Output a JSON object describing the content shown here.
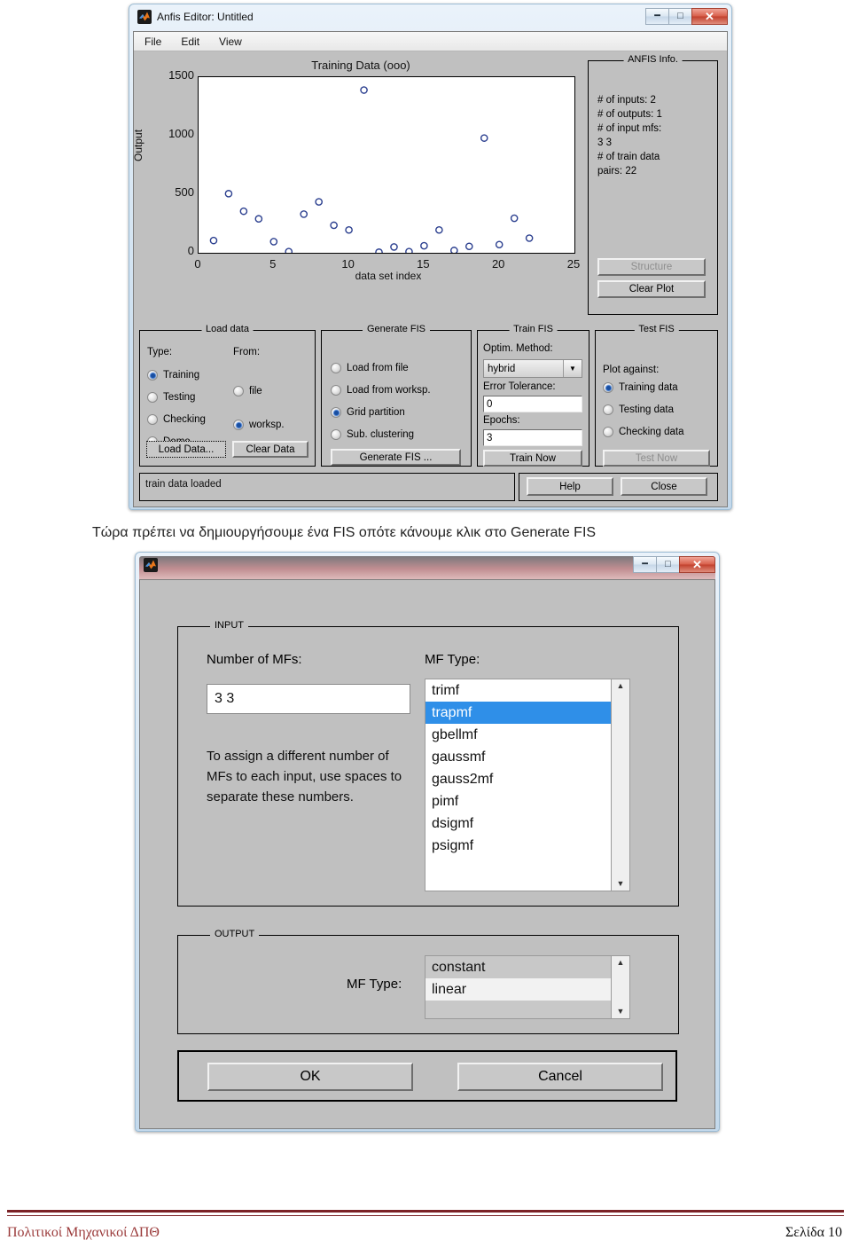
{
  "anfis_window": {
    "title": "Anfis Editor: Untitled",
    "icon": "matlab-logo-icon",
    "window_buttons": {
      "minimize": "minimize-icon",
      "maximize": "maximize-icon",
      "close": "close-icon"
    },
    "menu": [
      "File",
      "Edit",
      "View"
    ],
    "info_panel": {
      "title": "ANFIS Info.",
      "lines": [
        "# of inputs: 2",
        "# of outputs: 1",
        "# of input mfs:",
        "3  3",
        "# of train data",
        "pairs: 22"
      ],
      "structure_button": "Structure",
      "clear_plot_button": "Clear Plot"
    },
    "load_data": {
      "title": "Load data",
      "type_label": "Type:",
      "from_label": "From:",
      "type_options": [
        "Training",
        "Testing",
        "Checking",
        "Demo"
      ],
      "type_selected": "Training",
      "from_options": [
        "file",
        "worksp."
      ],
      "from_selected": "worksp.",
      "load_button": "Load Data...",
      "clear_button": "Clear Data"
    },
    "generate_fis": {
      "title": "Generate FIS",
      "options": [
        "Load from file",
        "Load from worksp.",
        "Grid partition",
        "Sub. clustering"
      ],
      "selected": "Grid partition",
      "button": "Generate FIS ..."
    },
    "train_fis": {
      "title": "Train FIS",
      "optim_label": "Optim. Method:",
      "optim_value": "hybrid",
      "error_label": "Error Tolerance:",
      "error_value": "0",
      "epochs_label": "Epochs:",
      "epochs_value": "3",
      "button": "Train Now"
    },
    "test_fis": {
      "title": "Test FIS",
      "plot_against_label": "Plot against:",
      "options": [
        "Training data",
        "Testing data",
        "Checking data"
      ],
      "selected": "Training data",
      "button": "Test Now"
    },
    "status_text": "train data loaded",
    "help_button": "Help",
    "close_button": "Close"
  },
  "chart_data": {
    "type": "scatter",
    "title": "Training Data (ooo)",
    "xlabel": "data set index",
    "ylabel": "Output",
    "xlim": [
      0,
      25
    ],
    "ylim": [
      0,
      1500
    ],
    "xticks": [
      0,
      5,
      10,
      15,
      20,
      25
    ],
    "yticks": [
      0,
      500,
      1000,
      1500
    ],
    "grid": false,
    "marker": "open-circle",
    "marker_color": "#2b3f8f",
    "x": [
      1,
      2,
      3,
      4,
      5,
      6,
      7,
      8,
      9,
      10,
      11,
      12,
      13,
      14,
      15,
      16,
      17,
      18,
      19,
      20,
      21,
      22
    ],
    "y": [
      105,
      505,
      355,
      290,
      95,
      10,
      330,
      435,
      235,
      195,
      1390,
      5,
      50,
      10,
      60,
      195,
      20,
      55,
      980,
      70,
      295,
      125
    ]
  },
  "caption": "Τώρα πρέπει να δημιουργήσουμε ένα FIS οπότε κάνουμε κλικ στο Generate FIS",
  "genfis_dialog": {
    "title": "",
    "icon": "matlab-logo-icon",
    "window_buttons": {
      "minimize": "minimize-icon",
      "maximize": "maximize-icon",
      "close": "close-icon"
    },
    "input": {
      "title": "INPUT",
      "num_mfs_label": "Number of MFs:",
      "num_mfs_value": "3 3",
      "hint": "To assign a different number of MFs to each input, use spaces to separate these numbers.",
      "mf_type_label": "MF Type:",
      "mf_types": [
        "trimf",
        "trapmf",
        "gbellmf",
        "gaussmf",
        "gauss2mf",
        "pimf",
        "dsigmf",
        "psigmf"
      ],
      "mf_type_selected": "trapmf"
    },
    "output": {
      "title": "OUTPUT",
      "mf_type_label": "MF Type:",
      "mf_types": [
        "constant",
        "linear"
      ],
      "mf_type_selected": "linear"
    },
    "ok_button": "OK",
    "cancel_button": "Cancel"
  },
  "footer": {
    "left": "Πολιτικοί Μηχανικοί ΔΠΘ",
    "right": "Σελίδα 10",
    "rule_color": "#7b2226"
  }
}
